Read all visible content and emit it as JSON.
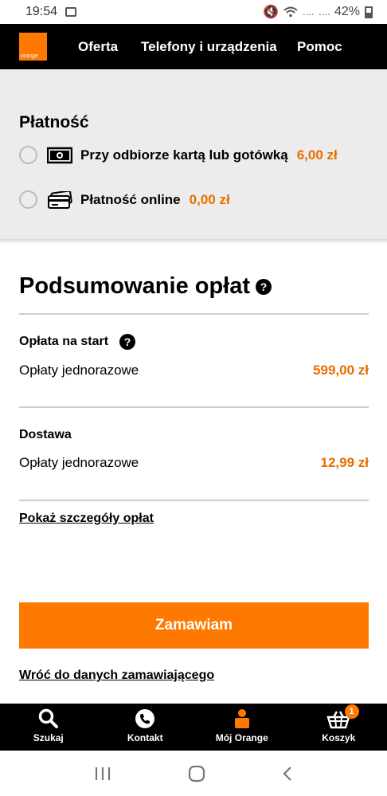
{
  "status_bar": {
    "time": "19:54",
    "battery": "42%",
    "signal": "‥‥"
  },
  "header": {
    "logo_text": "orange",
    "nav": [
      "Oferta",
      "Telefony i urządzenia",
      "Pomoc"
    ]
  },
  "payment": {
    "title": "Płatność",
    "options": [
      {
        "label": "Przy odbiorze kartą lub gotówką",
        "price": "6,00 zł",
        "icon": "cash-icon"
      },
      {
        "label": "Płatność online",
        "price": "0,00 zł",
        "icon": "card-icon"
      }
    ]
  },
  "summary": {
    "title": "Podsumowanie opłat",
    "help": "?",
    "sections": [
      {
        "title": "Opłata na start",
        "fee_label": "Opłaty jednorazowe",
        "amount": "599,00 zł"
      },
      {
        "title": "Dostawa",
        "fee_label": "Opłaty jednorazowe",
        "amount": "12,99 zł"
      }
    ],
    "details_link": "Pokaż szczegóły opłat"
  },
  "order_button": "Zamawiam",
  "back_link": "Wróć do danych zamawiającego",
  "bottom_nav": [
    {
      "label": "Szukaj",
      "icon": "search-icon"
    },
    {
      "label": "Kontakt",
      "icon": "phone-icon"
    },
    {
      "label": "Mój Orange",
      "icon": "user-icon"
    },
    {
      "label": "Koszyk",
      "icon": "basket-icon",
      "badge": "1"
    }
  ],
  "colors": {
    "accent": "#ff7900",
    "price": "#e96e00",
    "header": "#000000"
  }
}
